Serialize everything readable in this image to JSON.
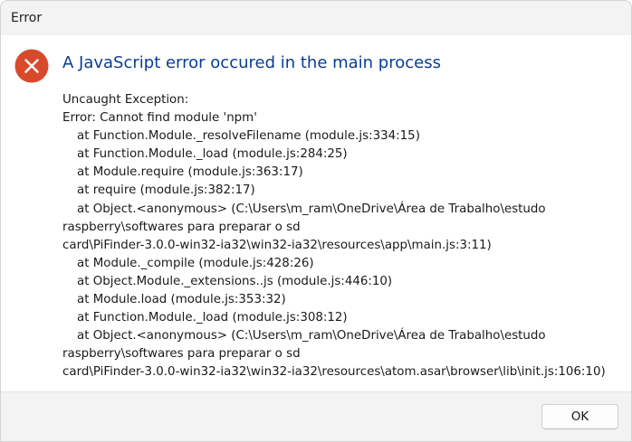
{
  "window": {
    "title": "Error"
  },
  "dialog": {
    "icon": "error-icon",
    "heading": "A JavaScript error occured in the main process",
    "lines": [
      {
        "text": "Uncaught Exception:",
        "indent": false
      },
      {
        "text": "Error: Cannot find module 'npm'",
        "indent": false
      },
      {
        "text": "at Function.Module._resolveFilename (module.js:334:15)",
        "indent": true
      },
      {
        "text": "at Function.Module._load (module.js:284:25)",
        "indent": true
      },
      {
        "text": "at Module.require (module.js:363:17)",
        "indent": true
      },
      {
        "text": "at require (module.js:382:17)",
        "indent": true
      },
      {
        "text": "at Object.<anonymous> (C:\\Users\\m_ram\\OneDrive\\Área de Trabalho\\estudo",
        "indent": true
      },
      {
        "text": "raspberry\\softwares para preparar o sd",
        "indent": false
      },
      {
        "text": "card\\PiFinder-3.0.0-win32-ia32\\win32-ia32\\resources\\app\\main.js:3:11)",
        "indent": false
      },
      {
        "text": "at Module._compile (module.js:428:26)",
        "indent": true
      },
      {
        "text": "at Object.Module._extensions..js (module.js:446:10)",
        "indent": true
      },
      {
        "text": "at Module.load (module.js:353:32)",
        "indent": true
      },
      {
        "text": "at Function.Module._load (module.js:308:12)",
        "indent": true
      },
      {
        "text": "at Object.<anonymous> (C:\\Users\\m_ram\\OneDrive\\Área de Trabalho\\estudo",
        "indent": true
      },
      {
        "text": "raspberry\\softwares para preparar o sd",
        "indent": false
      },
      {
        "text": "card\\PiFinder-3.0.0-win32-ia32\\win32-ia32\\resources\\atom.asar\\browser\\lib\\init.js:106:10)",
        "indent": false
      }
    ]
  },
  "footer": {
    "ok_label": "OK"
  },
  "colors": {
    "heading": "#0a3d91",
    "error_icon": "#d84a2c",
    "titlebar": "#f3f3f3",
    "footer": "#f3f3f3"
  }
}
